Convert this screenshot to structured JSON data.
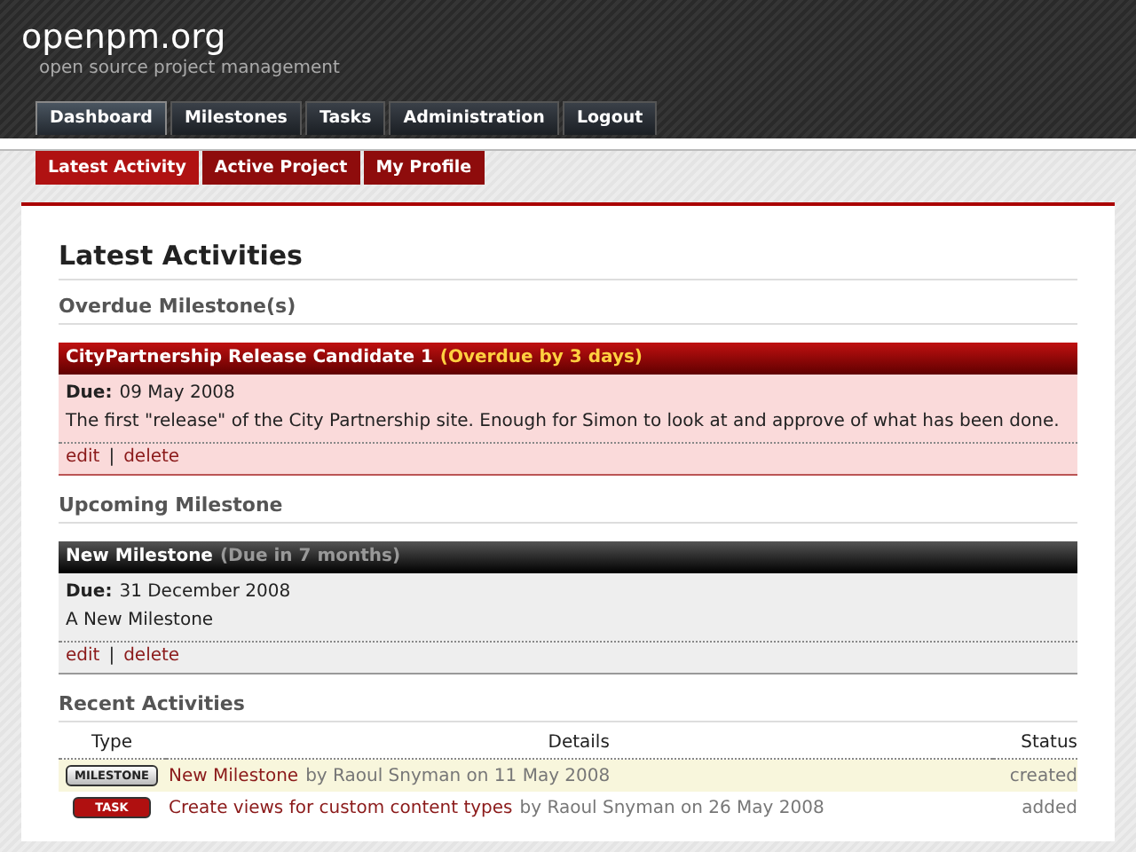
{
  "site": {
    "title": "openpm.org",
    "tagline": "open source project management"
  },
  "main_nav": [
    {
      "label": "Dashboard",
      "selected": true
    },
    {
      "label": "Milestones",
      "selected": false
    },
    {
      "label": "Tasks",
      "selected": false
    },
    {
      "label": "Administration",
      "selected": false
    },
    {
      "label": "Logout",
      "selected": false
    }
  ],
  "sub_nav": [
    {
      "label": "Latest Activity",
      "selected": true
    },
    {
      "label": "Active Project",
      "selected": false
    },
    {
      "label": "My Profile",
      "selected": false
    }
  ],
  "page_title": "Latest Activities",
  "sections": [
    {
      "heading": "Overdue Milestone(s)",
      "milestones": [
        {
          "kind": "overdue",
          "name": "CityPartnership Release Candidate 1",
          "note": "(Overdue by 3 days)",
          "due_label": "Due:",
          "due": "09 May 2008",
          "description": "The first \"release\" of the City Partnership site. Enough for Simon to look at and approve of what has been done.",
          "actions": [
            "edit",
            "delete"
          ],
          "separator": "|"
        }
      ]
    },
    {
      "heading": "Upcoming Milestone",
      "milestones": [
        {
          "kind": "upcoming",
          "name": "New Milestone",
          "note": "(Due in 7 months)",
          "due_label": "Due:",
          "due": "31 December 2008",
          "description": "A New Milestone",
          "actions": [
            "edit",
            "delete"
          ],
          "separator": "|"
        }
      ]
    }
  ],
  "recent": {
    "heading": "Recent Activities",
    "columns": [
      "Type",
      "Details",
      "Status"
    ],
    "rows": [
      {
        "type": "MILESTONE",
        "kind": "milestone",
        "link": "New Milestone",
        "by": "by Raoul Snyman on 11 May 2008",
        "status": "created"
      },
      {
        "type": "TASK",
        "kind": "task",
        "link": "Create views for custom content types",
        "by": "by Raoul Snyman on 26 May 2008",
        "status": "added"
      }
    ]
  }
}
